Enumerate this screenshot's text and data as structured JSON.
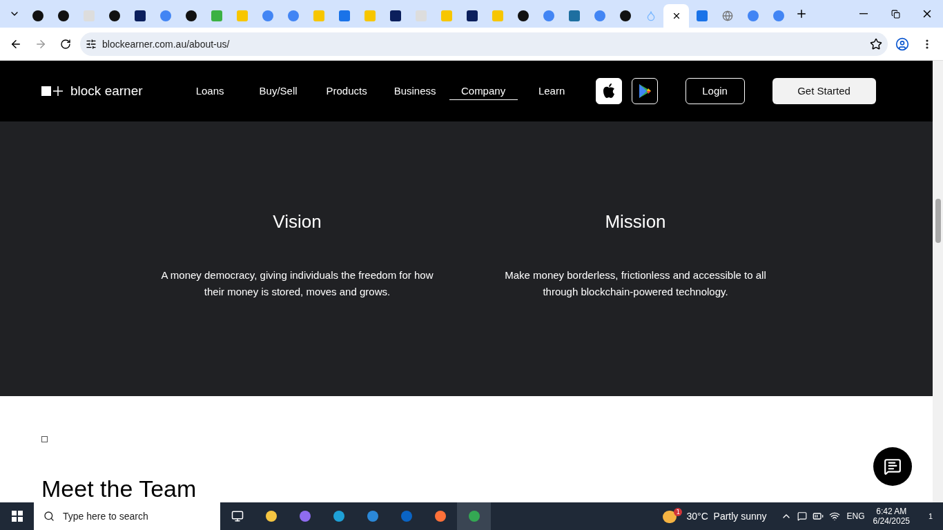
{
  "browser": {
    "tabs": [
      {
        "kind": "dark",
        "selected": false
      },
      {
        "kind": "dark",
        "selected": false
      },
      {
        "kind": "light",
        "selected": false
      },
      {
        "kind": "dark",
        "selected": false
      },
      {
        "kind": "navy",
        "selected": false
      },
      {
        "kind": "google",
        "selected": false
      },
      {
        "kind": "dark",
        "selected": false
      },
      {
        "kind": "green",
        "selected": false
      },
      {
        "kind": "yellow",
        "selected": false
      },
      {
        "kind": "google",
        "selected": false
      },
      {
        "kind": "google",
        "selected": false
      },
      {
        "kind": "yellow",
        "selected": false
      },
      {
        "kind": "blue",
        "selected": false
      },
      {
        "kind": "yellow",
        "selected": false
      },
      {
        "kind": "navy",
        "selected": false
      },
      {
        "kind": "light",
        "selected": false
      },
      {
        "kind": "yellow",
        "selected": false
      },
      {
        "kind": "navy",
        "selected": false
      },
      {
        "kind": "yellow",
        "selected": false
      },
      {
        "kind": "dark",
        "selected": false
      },
      {
        "kind": "google",
        "selected": false
      },
      {
        "kind": "teal",
        "selected": false
      },
      {
        "kind": "google",
        "selected": false
      },
      {
        "kind": "dark",
        "selected": false
      },
      {
        "kind": "drop",
        "selected": false
      },
      {
        "kind": "close",
        "selected": true
      },
      {
        "kind": "blue",
        "selected": false
      },
      {
        "kind": "globe",
        "selected": false
      },
      {
        "kind": "google",
        "selected": false
      },
      {
        "kind": "google",
        "selected": false
      }
    ],
    "url": "blockearner.com.au/about-us/"
  },
  "site": {
    "logo": "block earner",
    "nav": [
      {
        "label": "Loans",
        "selected": false
      },
      {
        "label": "Buy/Sell",
        "selected": false
      },
      {
        "label": "Products",
        "selected": false
      },
      {
        "label": "Business",
        "selected": false
      },
      {
        "label": "Company",
        "selected": true
      },
      {
        "label": "Learn",
        "selected": false
      }
    ],
    "login": "Login",
    "cta": "Get Started",
    "columns": [
      {
        "title": "Vision",
        "text": "A money democracy, giving individuals the freedom for how their money is stored, moves and grows."
      },
      {
        "title": "Mission",
        "text": "Make money borderless, frictionless and accessible to all through blockchain-powered technology."
      }
    ],
    "team_heading": "Meet the Team"
  },
  "taskbar": {
    "search_placeholder": "Type here to search",
    "weather": "30°C  Partly sunny",
    "weather_badge": "1",
    "language": "ENG",
    "time": "6:42 AM",
    "date": "6/24/2025",
    "notifications": "1"
  }
}
